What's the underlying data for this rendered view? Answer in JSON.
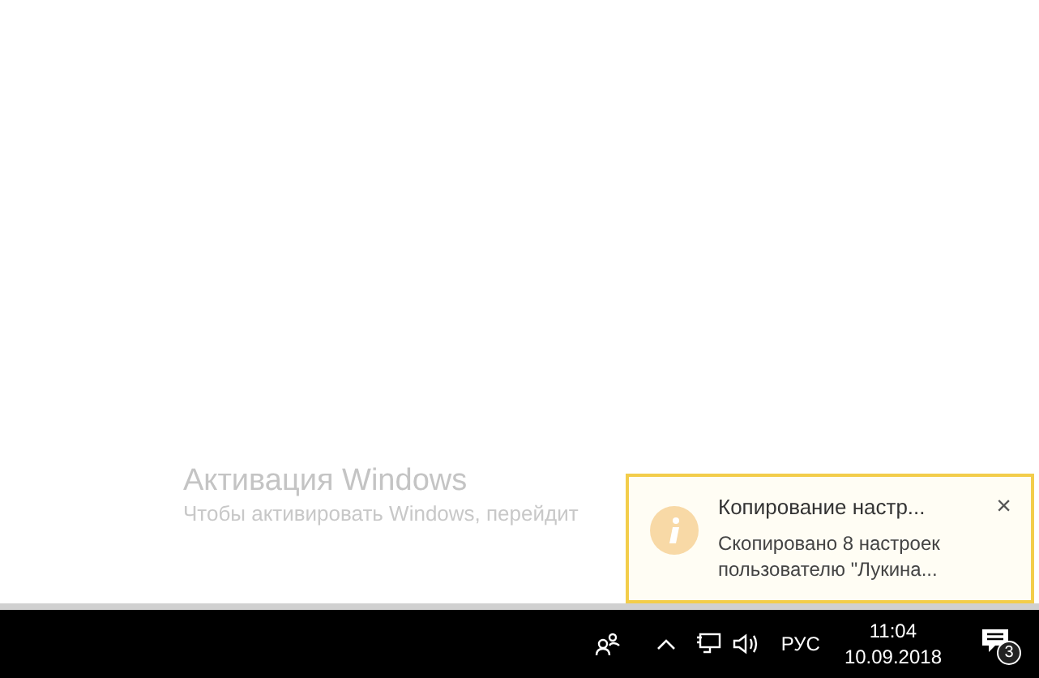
{
  "activation": {
    "title": "Активация Windows",
    "text": "Чтобы активировать Windows, перейдит"
  },
  "toast": {
    "title": "Копирование настр...",
    "body": "Скопировано 8 настроек пользователю \"Лукина...",
    "close": "×"
  },
  "taskbar": {
    "language": "РУС",
    "time": "11:04",
    "date": "10.09.2018",
    "notification_count": "3"
  }
}
